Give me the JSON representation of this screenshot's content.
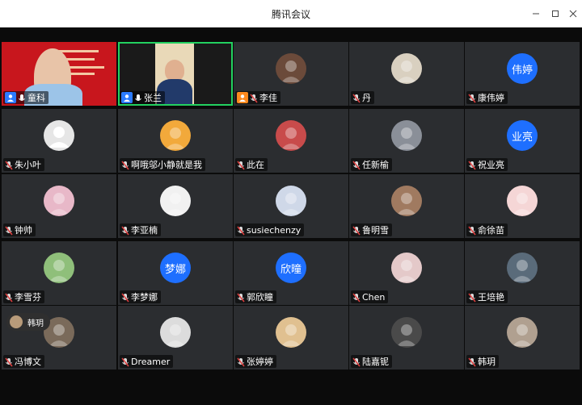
{
  "window": {
    "title": "腾讯会议",
    "controls": {
      "minimize": "—",
      "maximize": "☐",
      "close": "✕"
    }
  },
  "colors": {
    "tile_bg": "#2b2d30",
    "stage_bg": "#0b0b0b",
    "text_avatar": "#1e6fff",
    "active_speaker_ring": "#23d160",
    "mic_muted": "#e04040",
    "host_badge": "#2b7bff",
    "cohost_badge": "#ff8a1e"
  },
  "participants": [
    {
      "name": "童科",
      "avatar_type": "video-slide",
      "mic": "on",
      "badge": "host"
    },
    {
      "name": "张兰",
      "avatar_type": "video",
      "mic": "on",
      "badge": "host",
      "active": true
    },
    {
      "name": "李佳",
      "avatar_type": "photo",
      "mic": "muted",
      "badge": "cohost"
    },
    {
      "name": "丹",
      "avatar_type": "photo",
      "mic": "muted"
    },
    {
      "name": "康伟婷",
      "avatar_type": "text",
      "avatar_text": "伟婷",
      "mic": "muted"
    },
    {
      "name": "朱小叶",
      "avatar_type": "default",
      "mic": "muted"
    },
    {
      "name": "啊哦邬小静就是我",
      "avatar_type": "photo",
      "mic": "muted"
    },
    {
      "name": "此在",
      "avatar_type": "photo",
      "mic": "muted"
    },
    {
      "name": "任新榆",
      "avatar_type": "photo",
      "mic": "muted"
    },
    {
      "name": "祝业亮",
      "avatar_type": "text",
      "avatar_text": "业亮",
      "mic": "muted"
    },
    {
      "name": "钟帅",
      "avatar_type": "photo",
      "mic": "muted"
    },
    {
      "name": "李亚楠",
      "avatar_type": "photo",
      "mic": "muted"
    },
    {
      "name": "susiechenzy",
      "avatar_type": "photo",
      "mic": "muted"
    },
    {
      "name": "鲁明雪",
      "avatar_type": "photo",
      "mic": "muted"
    },
    {
      "name": "俞徐苗",
      "avatar_type": "photo",
      "mic": "muted"
    },
    {
      "name": "李雪芬",
      "avatar_type": "photo",
      "mic": "muted"
    },
    {
      "name": "李梦娜",
      "avatar_type": "text",
      "avatar_text": "梦娜",
      "mic": "muted"
    },
    {
      "name": "郭欣瞳",
      "avatar_type": "text",
      "avatar_text": "欣曈",
      "mic": "muted"
    },
    {
      "name": "Chen",
      "avatar_type": "photo",
      "mic": "muted"
    },
    {
      "name": "王培艳",
      "avatar_type": "photo",
      "mic": "muted"
    },
    {
      "name": "冯博文",
      "avatar_type": "photo",
      "mic": "muted"
    },
    {
      "name": "Dreamer",
      "avatar_type": "photo",
      "mic": "muted"
    },
    {
      "name": "张婷婷",
      "avatar_type": "photo",
      "mic": "muted"
    },
    {
      "name": "陆嘉铌",
      "avatar_type": "photo",
      "mic": "muted"
    },
    {
      "name": "韩玥",
      "avatar_type": "photo",
      "mic": "muted"
    }
  ],
  "floating_speaker": {
    "name": "韩玥"
  }
}
